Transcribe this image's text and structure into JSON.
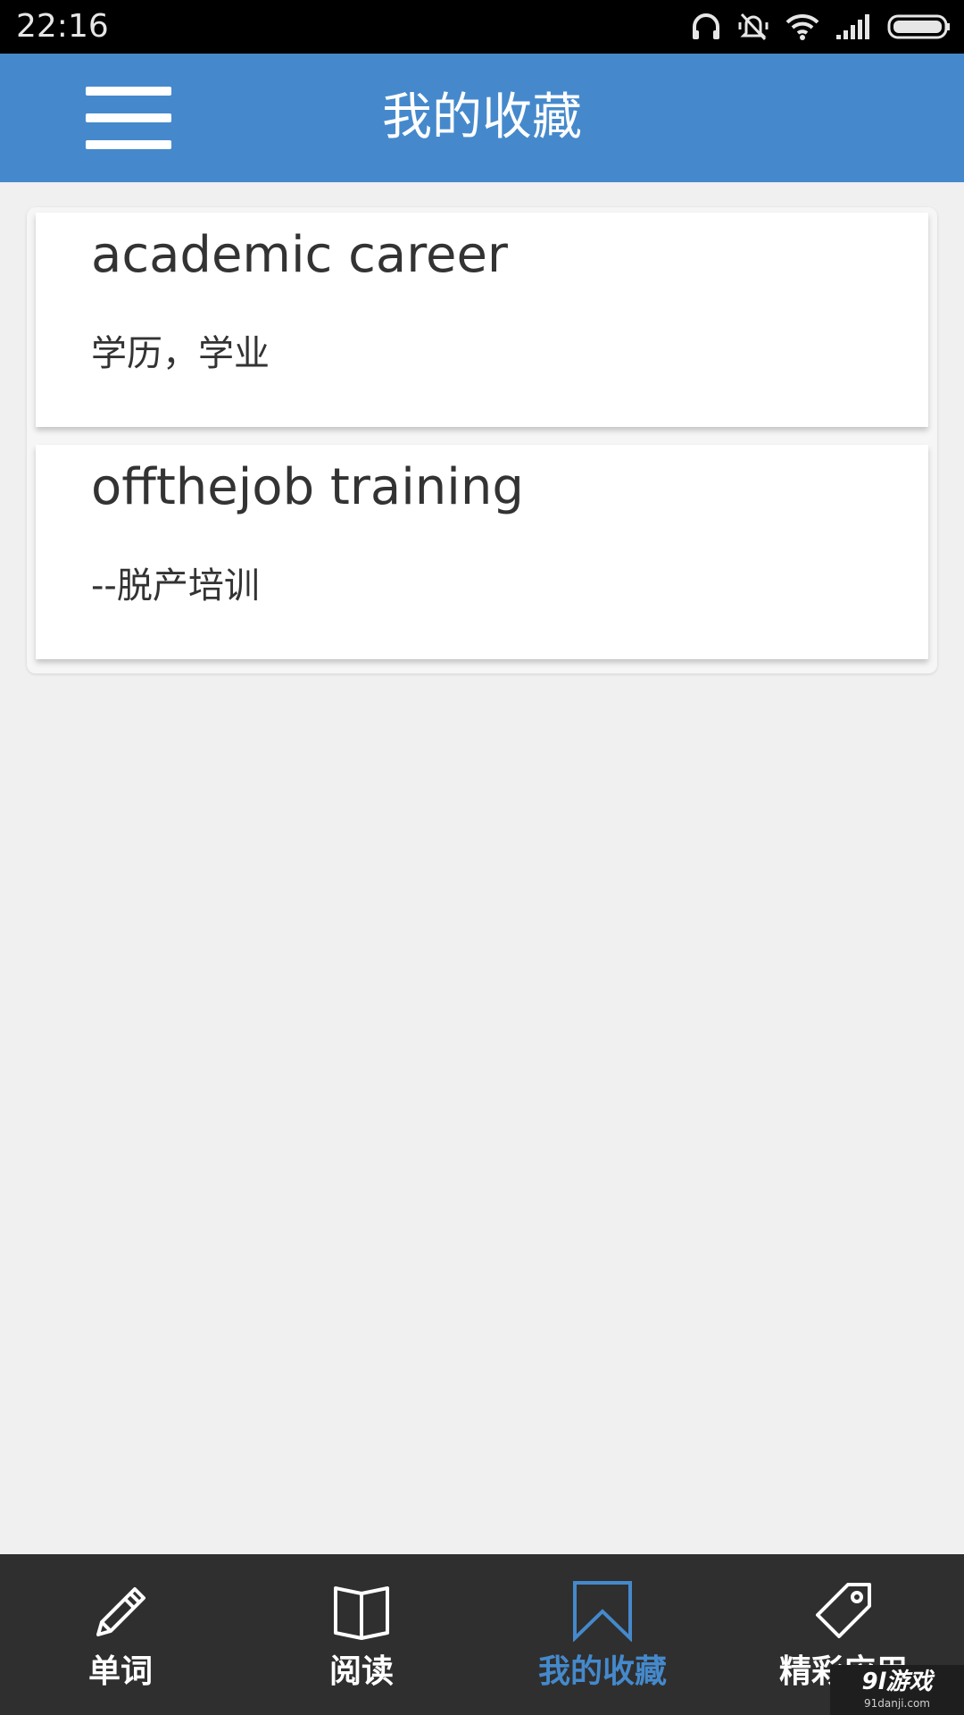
{
  "status_bar": {
    "time": "22:16",
    "icons": [
      "headphones-icon",
      "mute-icon",
      "wifi-icon",
      "signal-icon",
      "battery-icon"
    ]
  },
  "app_bar": {
    "title": "我的收藏",
    "menu_icon": "hamburger-menu-icon"
  },
  "favorites": [
    {
      "word": "academic career",
      "meaning": "学历，学业"
    },
    {
      "word": "offthejob training",
      "meaning": "--脱产培训"
    }
  ],
  "bottom_nav": {
    "items": [
      {
        "label": "单词",
        "icon": "pencil-icon"
      },
      {
        "label": "阅读",
        "icon": "book-icon"
      },
      {
        "label": "我的收藏",
        "icon": "bookmark-icon",
        "active": true
      },
      {
        "label": "精彩应用",
        "icon": "tag-icon"
      }
    ]
  },
  "watermark": {
    "logo": "9l游戏",
    "url": "91danji.com"
  },
  "colors": {
    "primary": "#4589cc",
    "background": "#f0f0f0",
    "nav_background": "#2f2f2f",
    "text": "#333333"
  }
}
